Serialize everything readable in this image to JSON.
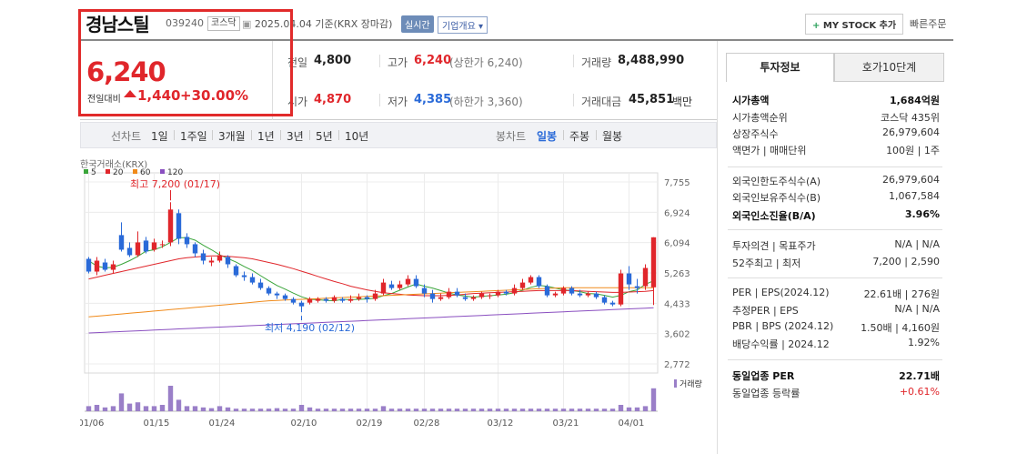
{
  "header": {
    "name": "경남스틸",
    "code": "039240",
    "market": "코스닥",
    "date_note": "2025.04.04  기준(KRX 장마감)",
    "live_label": "실시간",
    "overview_label": "기업개요 ▾",
    "mystock_label": "MY STOCK 추가",
    "quick_order": "빠른주문"
  },
  "price": {
    "current": "6,240",
    "prev_label": "전일대비",
    "change": "1,440",
    "change_pct": "+30.00%"
  },
  "summary": {
    "prev_close_label": "전일",
    "prev_close": "4,800",
    "open_label": "시가",
    "open": "4,870",
    "high_label": "고가",
    "high": "6,240",
    "upper_limit": "(상한가 6,240)",
    "low_label": "저가",
    "low": "4,385",
    "lower_limit": "(하한가 3,360)",
    "volume_label": "거래량",
    "volume": "8,488,990",
    "amount_label": "거래대금",
    "amount": "45,851",
    "amount_unit": "백만"
  },
  "toolbar": {
    "line_chart": "선차트",
    "periods": [
      "1일",
      "1주일",
      "3개월",
      "1년",
      "3년",
      "5년",
      "10년"
    ],
    "candle_chart": "봉차트",
    "candle_periods": [
      "일봉",
      "주봉",
      "월봉"
    ],
    "selected": "일봉"
  },
  "chart_meta": {
    "source": "한국거래소(KRX)",
    "ma": [
      {
        "label": "5",
        "color": "#3aa53a"
      },
      {
        "label": "20",
        "color": "#e0262b"
      },
      {
        "label": "60",
        "color": "#f08a1a"
      },
      {
        "label": "120",
        "color": "#8a4fc0"
      }
    ],
    "high_note": "최고 7,200 (01/17)",
    "low_note": "최저 4,190 (02/12)",
    "volume_label": "거래량"
  },
  "chart_data": {
    "type": "candlestick",
    "x_tick_labels": [
      "01/06",
      "01/15",
      "01/24",
      "02/10",
      "02/19",
      "02/28",
      "03/12",
      "03/21",
      "04/01"
    ],
    "y_tick_labels": [
      "7,755",
      "6,924",
      "6,094",
      "5,263",
      "4,433",
      "3,602",
      "2,772"
    ],
    "ylim": [
      2772,
      7755
    ],
    "candles": [
      {
        "o": 5650,
        "c": 5300,
        "h": 5700,
        "l": 5250
      },
      {
        "o": 5300,
        "c": 5600,
        "h": 5700,
        "l": 5200
      },
      {
        "o": 5550,
        "c": 5350,
        "h": 5650,
        "l": 5300
      },
      {
        "o": 5350,
        "c": 5500,
        "h": 5600,
        "l": 5250
      },
      {
        "o": 6300,
        "c": 5900,
        "h": 6650,
        "l": 5850
      },
      {
        "o": 5950,
        "c": 5750,
        "h": 6100,
        "l": 5700
      },
      {
        "o": 5750,
        "c": 6100,
        "h": 6400,
        "l": 5700
      },
      {
        "o": 6150,
        "c": 5850,
        "h": 6250,
        "l": 5800
      },
      {
        "o": 5900,
        "c": 6100,
        "h": 6200,
        "l": 5850
      },
      {
        "o": 6050,
        "c": 6050,
        "h": 6150,
        "l": 5950
      },
      {
        "o": 6100,
        "c": 7000,
        "h": 7200,
        "l": 6000
      },
      {
        "o": 6900,
        "c": 6200,
        "h": 7000,
        "l": 6050
      },
      {
        "o": 6250,
        "c": 6050,
        "h": 6350,
        "l": 5950
      },
      {
        "o": 6050,
        "c": 5800,
        "h": 6100,
        "l": 5700
      },
      {
        "o": 5800,
        "c": 5600,
        "h": 5900,
        "l": 5500
      },
      {
        "o": 5550,
        "c": 5600,
        "h": 5700,
        "l": 5450
      },
      {
        "o": 5600,
        "c": 5750,
        "h": 5850,
        "l": 5550
      },
      {
        "o": 5700,
        "c": 5500,
        "h": 5750,
        "l": 5400
      },
      {
        "o": 5450,
        "c": 5200,
        "h": 5500,
        "l": 5150
      },
      {
        "o": 5200,
        "c": 5150,
        "h": 5300,
        "l": 5050
      },
      {
        "o": 5150,
        "c": 5000,
        "h": 5250,
        "l": 4950
      },
      {
        "o": 5000,
        "c": 4850,
        "h": 5100,
        "l": 4800
      },
      {
        "o": 4850,
        "c": 4700,
        "h": 4900,
        "l": 4650
      },
      {
        "o": 4700,
        "c": 4650,
        "h": 4750,
        "l": 4550
      },
      {
        "o": 4650,
        "c": 4550,
        "h": 4700,
        "l": 4500
      },
      {
        "o": 4550,
        "c": 4450,
        "h": 4600,
        "l": 4400
      },
      {
        "o": 4450,
        "c": 4350,
        "h": 4500,
        "l": 4190
      },
      {
        "o": 4450,
        "c": 4550,
        "h": 4600,
        "l": 4400
      },
      {
        "o": 4500,
        "c": 4550,
        "h": 4600,
        "l": 4450
      },
      {
        "o": 4550,
        "c": 4500,
        "h": 4600,
        "l": 4450
      },
      {
        "o": 4500,
        "c": 4600,
        "h": 4650,
        "l": 4450
      },
      {
        "o": 4550,
        "c": 4500,
        "h": 4600,
        "l": 4450
      },
      {
        "o": 4500,
        "c": 4550,
        "h": 4650,
        "l": 4450
      },
      {
        "o": 4550,
        "c": 4600,
        "h": 4700,
        "l": 4500
      },
      {
        "o": 4600,
        "c": 4550,
        "h": 4650,
        "l": 4450
      },
      {
        "o": 4550,
        "c": 4700,
        "h": 4800,
        "l": 4500
      },
      {
        "o": 4700,
        "c": 5000,
        "h": 5100,
        "l": 4650
      },
      {
        "o": 4950,
        "c": 4850,
        "h": 5050,
        "l": 4800
      },
      {
        "o": 4850,
        "c": 4950,
        "h": 5050,
        "l": 4800
      },
      {
        "o": 4950,
        "c": 5100,
        "h": 5200,
        "l": 4900
      },
      {
        "o": 5100,
        "c": 4900,
        "h": 5200,
        "l": 4850
      },
      {
        "o": 4850,
        "c": 4700,
        "h": 4950,
        "l": 4600
      },
      {
        "o": 4700,
        "c": 4550,
        "h": 4800,
        "l": 4450
      },
      {
        "o": 4550,
        "c": 4600,
        "h": 4700,
        "l": 4500
      },
      {
        "o": 4600,
        "c": 4750,
        "h": 4850,
        "l": 4550
      },
      {
        "o": 4750,
        "c": 4650,
        "h": 4850,
        "l": 4600
      },
      {
        "o": 4600,
        "c": 4550,
        "h": 4700,
        "l": 4500
      },
      {
        "o": 4550,
        "c": 4600,
        "h": 4650,
        "l": 4500
      },
      {
        "o": 4600,
        "c": 4700,
        "h": 4750,
        "l": 4550
      },
      {
        "o": 4650,
        "c": 4650,
        "h": 4700,
        "l": 4550
      },
      {
        "o": 4650,
        "c": 4750,
        "h": 4800,
        "l": 4600
      },
      {
        "o": 4750,
        "c": 4700,
        "h": 4800,
        "l": 4650
      },
      {
        "o": 4700,
        "c": 4850,
        "h": 4950,
        "l": 4650
      },
      {
        "o": 4850,
        "c": 5000,
        "h": 5100,
        "l": 4800
      },
      {
        "o": 5000,
        "c": 5150,
        "h": 5200,
        "l": 4950
      },
      {
        "o": 5150,
        "c": 4900,
        "h": 5200,
        "l": 4850
      },
      {
        "o": 4900,
        "c": 4650,
        "h": 4950,
        "l": 4600
      },
      {
        "o": 4650,
        "c": 4700,
        "h": 4750,
        "l": 4600
      },
      {
        "o": 4700,
        "c": 4850,
        "h": 4900,
        "l": 4650
      },
      {
        "o": 4850,
        "c": 4700,
        "h": 4900,
        "l": 4650
      },
      {
        "o": 4700,
        "c": 4650,
        "h": 4800,
        "l": 4600
      },
      {
        "o": 4650,
        "c": 4700,
        "h": 4750,
        "l": 4600
      },
      {
        "o": 4700,
        "c": 4600,
        "h": 4750,
        "l": 4550
      },
      {
        "o": 4600,
        "c": 4450,
        "h": 4650,
        "l": 4400
      },
      {
        "o": 4450,
        "c": 4400,
        "h": 4500,
        "l": 4350
      },
      {
        "o": 4400,
        "c": 5250,
        "h": 5350,
        "l": 4350
      },
      {
        "o": 5250,
        "c": 4950,
        "h": 5450,
        "l": 4800
      },
      {
        "o": 4900,
        "c": 4850,
        "h": 5100,
        "l": 4700
      },
      {
        "o": 4900,
        "c": 5400,
        "h": 5500,
        "l": 4800
      },
      {
        "o": 4870,
        "c": 6240,
        "h": 6240,
        "l": 4385
      }
    ],
    "ma_series": [
      {
        "label": "5",
        "values": [
          5600,
          5450,
          5400,
          5420,
          5500,
          5600,
          5720,
          5860,
          5900,
          5980,
          6100,
          6230,
          6230,
          6160,
          6020,
          5900,
          5760,
          5660,
          5560,
          5440,
          5330,
          5190,
          5050,
          4920,
          4820,
          4710,
          4610,
          4540,
          4530,
          4510,
          4500,
          4540,
          4530,
          4540,
          4550,
          4570,
          4640,
          4700,
          4790,
          4880,
          4960,
          4900,
          4850,
          4780,
          4710,
          4660,
          4630,
          4600,
          4620,
          4640,
          4660,
          4680,
          4720,
          4790,
          4870,
          4920,
          4900,
          4850,
          4800,
          4780,
          4750,
          4700,
          4690,
          4650,
          4600,
          4650,
          4750,
          4800,
          4950,
          5050
        ]
      },
      {
        "label": "20",
        "values": [
          5100,
          5150,
          5200,
          5250,
          5300,
          5350,
          5400,
          5450,
          5500,
          5550,
          5600,
          5650,
          5680,
          5700,
          5720,
          5730,
          5730,
          5720,
          5700,
          5680,
          5650,
          5600,
          5550,
          5500,
          5440,
          5380,
          5310,
          5240,
          5170,
          5100,
          5030,
          4970,
          4900,
          4850,
          4800,
          4760,
          4720,
          4700,
          4680,
          4660,
          4650,
          4640,
          4640,
          4640,
          4650,
          4660,
          4680,
          4700,
          4710,
          4720,
          4730,
          4740,
          4750,
          4760,
          4770,
          4780,
          4780,
          4780,
          4780,
          4780,
          4770,
          4760,
          4750,
          4740,
          4730,
          4730,
          4740,
          4750,
          4760,
          4780
        ]
      },
      {
        "label": "60",
        "values": [
          4060,
          4080,
          4100,
          4120,
          4140,
          4160,
          4180,
          4200,
          4220,
          4240,
          4260,
          4280,
          4300,
          4320,
          4340,
          4360,
          4380,
          4400,
          4420,
          4440,
          4460,
          4480,
          4500,
          4510,
          4520,
          4530,
          4540,
          4550,
          4560,
          4570,
          4580,
          4590,
          4600,
          4610,
          4620,
          4630,
          4640,
          4650,
          4660,
          4670,
          4680,
          4690,
          4700,
          4710,
          4720,
          4730,
          4740,
          4750,
          4760,
          4770,
          4780,
          4790,
          4800,
          4810,
          4820,
          4830,
          4840,
          4850,
          4860,
          4860,
          4860,
          4860,
          4860,
          4860,
          4860,
          4860,
          4860,
          4860,
          4860,
          4860
        ]
      },
      {
        "label": "120",
        "values": [
          3620,
          3630,
          3640,
          3650,
          3660,
          3670,
          3680,
          3690,
          3700,
          3710,
          3720,
          3730,
          3740,
          3750,
          3760,
          3770,
          3780,
          3790,
          3800,
          3810,
          3820,
          3830,
          3840,
          3850,
          3860,
          3870,
          3880,
          3890,
          3900,
          3910,
          3920,
          3930,
          3940,
          3950,
          3960,
          3970,
          3980,
          3990,
          4000,
          4010,
          4020,
          4030,
          4040,
          4050,
          4060,
          4070,
          4080,
          4090,
          4100,
          4110,
          4120,
          4130,
          4140,
          4150,
          4160,
          4170,
          4180,
          4190,
          4200,
          4210,
          4220,
          4230,
          4240,
          4250,
          4260,
          4270,
          4280,
          4290,
          4300,
          4310
        ]
      }
    ],
    "volume_relative": [
      0.2,
      0.25,
      0.15,
      0.2,
      0.7,
      0.3,
      0.35,
      0.2,
      0.2,
      0.25,
      1.0,
      0.45,
      0.2,
      0.2,
      0.15,
      0.12,
      0.2,
      0.15,
      0.1,
      0.1,
      0.1,
      0.1,
      0.1,
      0.12,
      0.1,
      0.1,
      0.25,
      0.15,
      0.1,
      0.1,
      0.1,
      0.1,
      0.1,
      0.1,
      0.1,
      0.1,
      0.2,
      0.1,
      0.1,
      0.1,
      0.1,
      0.1,
      0.1,
      0.1,
      0.1,
      0.1,
      0.1,
      0.1,
      0.1,
      0.1,
      0.1,
      0.1,
      0.1,
      0.1,
      0.1,
      0.1,
      0.1,
      0.1,
      0.1,
      0.1,
      0.1,
      0.1,
      0.1,
      0.1,
      0.1,
      0.25,
      0.15,
      0.15,
      0.2,
      0.9
    ]
  },
  "side": {
    "tab_active": "투자정보",
    "tab_other": "호가10단계",
    "rows": [
      {
        "label": "시가총액",
        "value": "1,684억원",
        "bold": true
      },
      {
        "label": "시가총액순위",
        "value": "코스닥 435위"
      },
      {
        "label": "상장주식수",
        "value": "26,979,604"
      },
      {
        "label": "액면가 | 매매단위",
        "value": "100원 | 1주"
      },
      {
        "label": "외국인한도주식수(A)",
        "value": "26,979,604"
      },
      {
        "label": "외국인보유주식수(B)",
        "value": "1,067,584"
      },
      {
        "label": "외국인소진율(B/A)",
        "value": "3.96%",
        "bold": true
      },
      {
        "label": "투자의견 | 목표주가",
        "value": "N/A | N/A"
      },
      {
        "label": "52주최고 | 최저",
        "value": "7,200 | 2,590"
      },
      {
        "label": "PER | EPS(2024.12)",
        "value": "22.61배 | 276원"
      },
      {
        "label": "추정PER | EPS",
        "value": "N/A | N/A"
      },
      {
        "label": "PBR | BPS (2024.12)",
        "value": "1.50배 | 4,160원"
      },
      {
        "label": "배당수익률 | 2024.12",
        "value": "1.92%"
      },
      {
        "label": "동일업종 PER",
        "value": "22.71배",
        "bold": true
      },
      {
        "label": "동일업종 등락률",
        "value": "+0.61%",
        "red": true
      }
    ]
  }
}
